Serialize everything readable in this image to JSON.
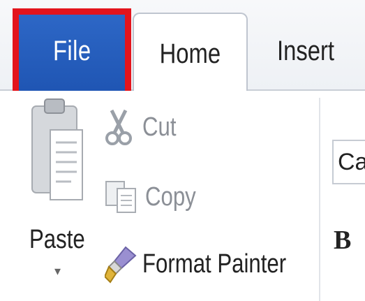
{
  "tabs": [
    {
      "label": "File"
    },
    {
      "label": "Home"
    },
    {
      "label": "Insert"
    }
  ],
  "clipboard": {
    "paste_label": "Paste",
    "paste_dropdown": "▾",
    "cut_label": "Cut",
    "copy_label": "Copy",
    "format_painter_label": "Format Painter"
  },
  "font_group": {
    "font_name": "Ca",
    "bold_glyph": "B"
  },
  "colors": {
    "file_tab": "#1f55b3",
    "highlight": "#e3141c"
  },
  "icons": {
    "paste": "clipboard-icon",
    "cut": "scissors-icon",
    "copy": "copy-icon",
    "format_painter": "paintbrush-icon"
  }
}
